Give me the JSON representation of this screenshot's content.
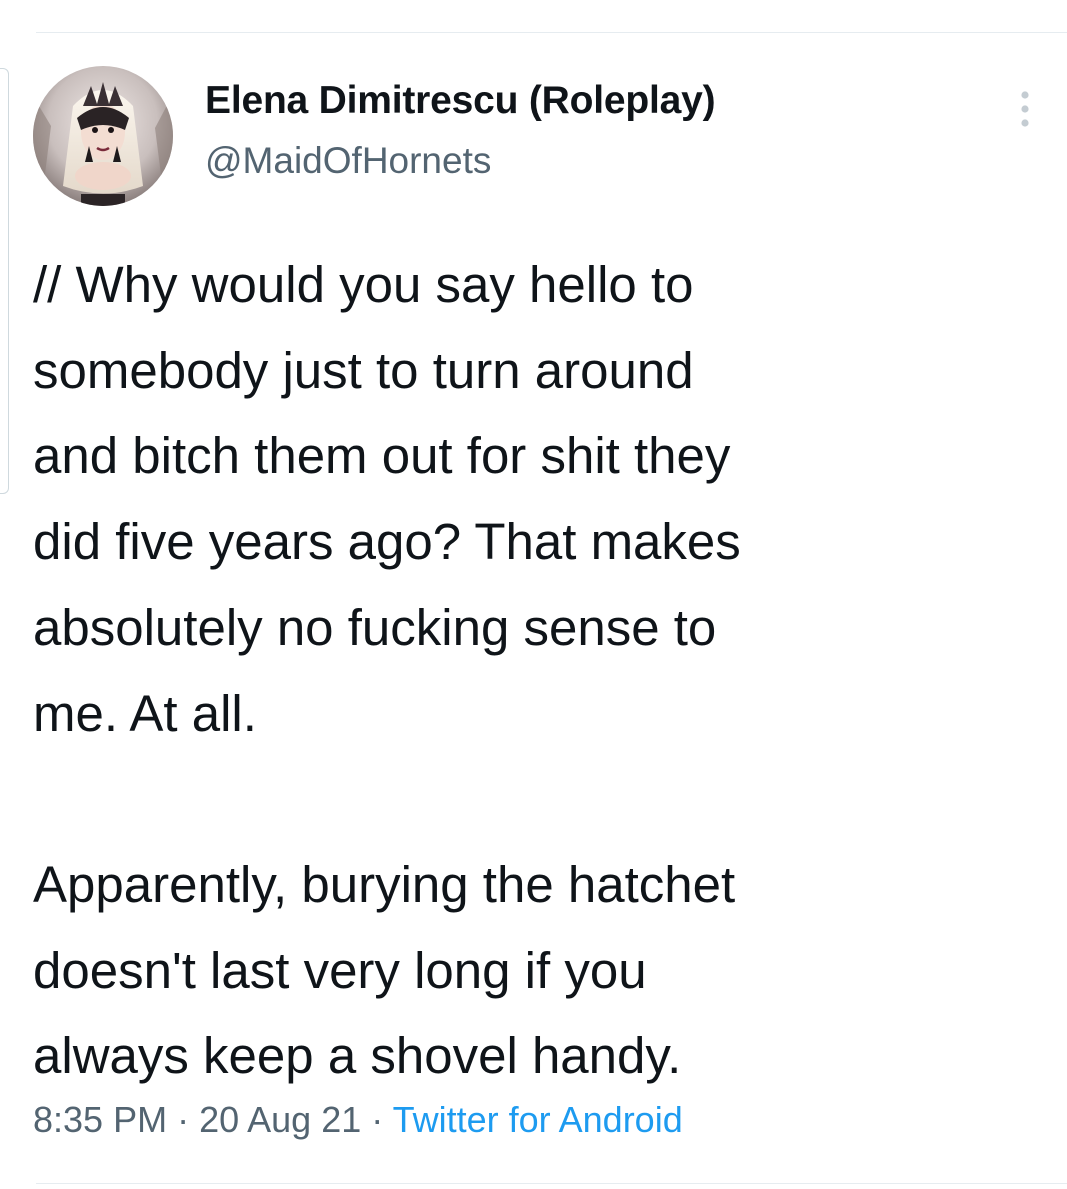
{
  "tweet": {
    "display_name": "Elena Dimitrescu (Roleplay)",
    "handle": "@MaidOfHornets",
    "text_paragraph_1": "// Why would you say hello to\nsomebody just to turn around\nand bitch them out for shit they\ndid five years ago? That makes\nabsolutely no fucking sense to\nme. At all.",
    "text_paragraph_2": "Apparently, burying the hatchet\ndoesn't last very long if you\nalways keep a shovel handy.",
    "time": "8:35 PM",
    "separator": " · ",
    "date": "20 Aug 21",
    "source": "Twitter for Android"
  },
  "colors": {
    "text_primary": "#0f1419",
    "text_secondary": "#536471",
    "link": "#1d9bf0",
    "divider": "#e6ecf0"
  },
  "icons": {
    "more": "more-vertical-icon",
    "avatar": "profile-avatar"
  }
}
